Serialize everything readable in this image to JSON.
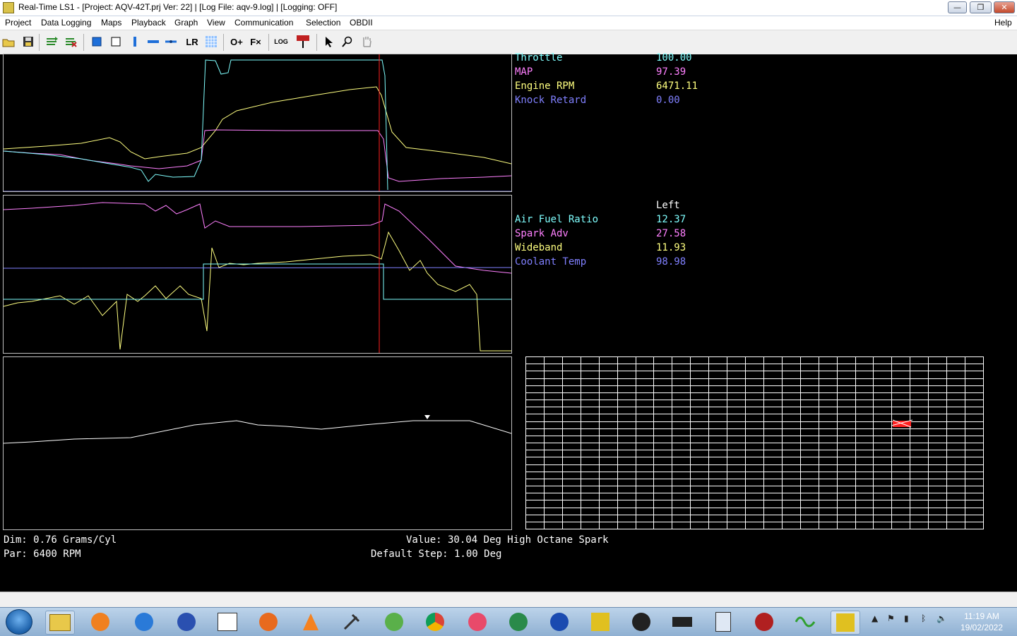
{
  "window": {
    "title": "Real-Time LS1 - [Project: AQV-42T.prj Ver: 22] | [Log File: aqv-9.log] | [Logging: OFF]"
  },
  "menu": [
    "Project",
    "Data Logging",
    "Maps",
    "Playback",
    "Graph",
    "View",
    "Communication",
    "Selection",
    "OBDII"
  ],
  "menu_help": "Help",
  "toolbar_text": {
    "lr": "LR",
    "log": "LOG",
    "zoom_in": "O+",
    "fx": "F×"
  },
  "readouts_top": [
    {
      "label": "Throttle",
      "value": "100.00",
      "color": "#80ffff"
    },
    {
      "label": "MAP",
      "value": "97.39",
      "color": "#ff80ff"
    },
    {
      "label": "Engine RPM",
      "value": "6471.11",
      "color": "#ffff80"
    },
    {
      "label": "Knock Retard",
      "value": "0.00",
      "color": "#8080ff"
    }
  ],
  "readouts_bottom_header": "Left",
  "readouts_bottom": [
    {
      "label": "Air Fuel Ratio",
      "value": "12.37",
      "color": "#80ffff"
    },
    {
      "label": "Spark Adv",
      "value": "27.58",
      "color": "#ff80ff"
    },
    {
      "label": "Wideband",
      "value": "11.93",
      "color": "#ffff80"
    },
    {
      "label": "Coolant Temp",
      "value": "98.98",
      "color": "#8080ff"
    }
  ],
  "status": {
    "dim": "Dim: 0.76 Grams/Cyl",
    "par": "Par: 6400 RPM",
    "value": "Value: 30.04 Deg High Octane Spark",
    "step": "Default Step: 1.00 Deg"
  },
  "taskbar": {
    "time": "11:19 AM",
    "date": "19/02/2022",
    "apps": [
      "explorer",
      "media-player",
      "internet-explorer",
      "headphones",
      "calendar-321",
      "firefox",
      "vlc",
      "tools",
      "app-green",
      "chrome",
      "firefox-dev",
      "globe",
      "malwarebytes",
      "rt-ls1",
      "obs",
      "chip",
      "calculator",
      "gauge",
      "audio-wave",
      "rt-ls1-active"
    ]
  }
}
